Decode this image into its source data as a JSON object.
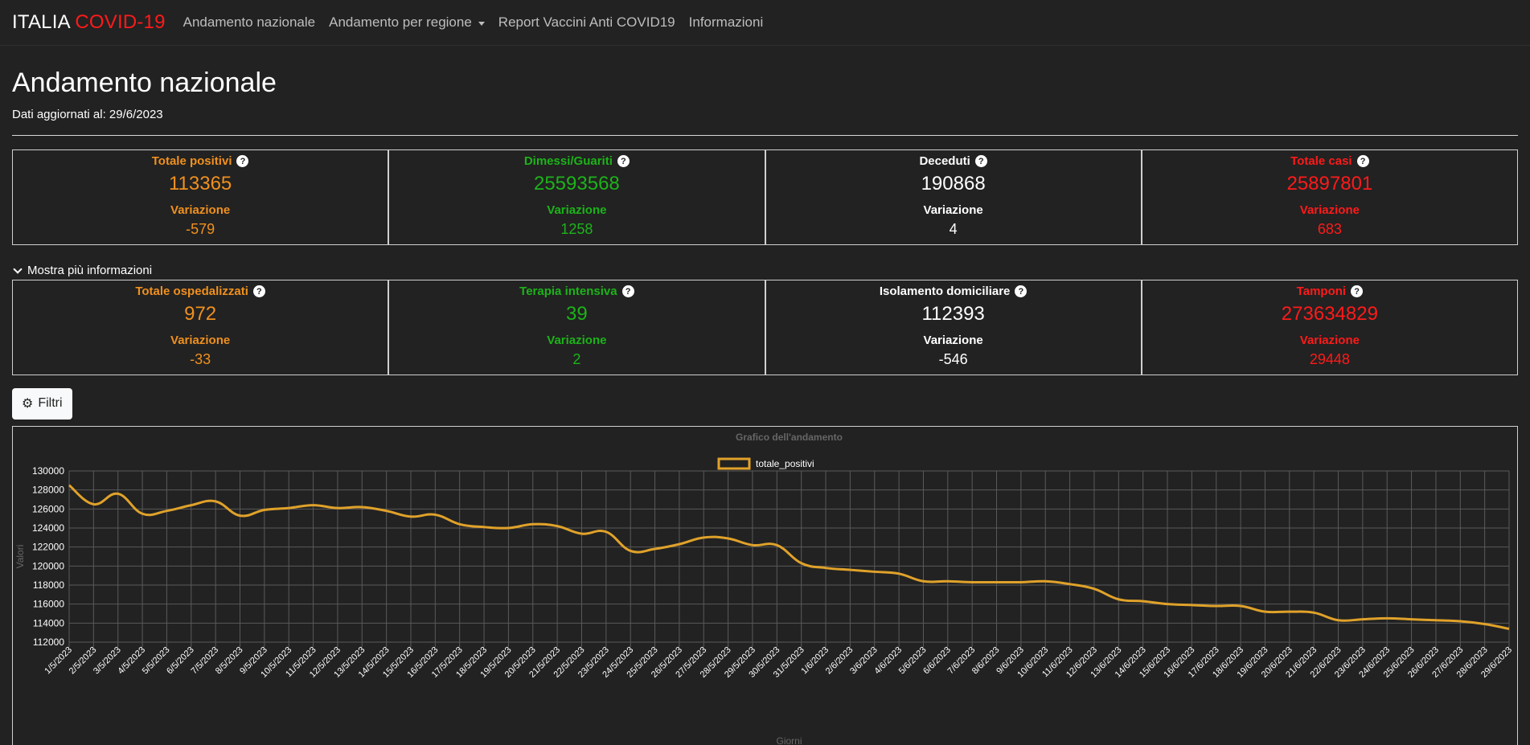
{
  "navbar": {
    "brand_left": "ITALIA",
    "brand_right": "COVID-19",
    "links": [
      "Andamento nazionale",
      "Andamento per regione",
      "Report Vaccini Anti COVID19",
      "Informazioni"
    ]
  },
  "page": {
    "title": "Andamento nazionale",
    "updated": "Dati aggiornati al: 29/6/2023",
    "more_info": "Mostra più informazioni",
    "filter_button": "Filtri"
  },
  "cards_top": [
    {
      "title": "Totale positivi",
      "value": "113365",
      "sub": "Variazione",
      "variation": "-579",
      "color": "#f0901e"
    },
    {
      "title": "Dimessi/Guariti",
      "value": "25593568",
      "sub": "Variazione",
      "variation": "1258",
      "color": "#1cb319"
    },
    {
      "title": "Deceduti",
      "value": "190868",
      "sub": "Variazione",
      "variation": "4",
      "color": "#ffffff"
    },
    {
      "title": "Totale casi",
      "value": "25897801",
      "sub": "Variazione",
      "variation": "683",
      "color": "#ff1a1a"
    }
  ],
  "cards_bottom": [
    {
      "title": "Totale ospedalizzati",
      "value": "972",
      "sub": "Variazione",
      "variation": "-33",
      "color": "#f0901e"
    },
    {
      "title": "Terapia intensiva",
      "value": "39",
      "sub": "Variazione",
      "variation": "2",
      "color": "#1cb319"
    },
    {
      "title": "Isolamento domiciliare",
      "value": "112393",
      "sub": "Variazione",
      "variation": "-546",
      "color": "#ffffff"
    },
    {
      "title": "Tamponi",
      "value": "273634829",
      "sub": "Variazione",
      "variation": "29448",
      "color": "#ff1a1a"
    }
  ],
  "icons": {
    "help": "question-circle-icon",
    "expand": "chevron-down-icon",
    "filter": "gears-icon"
  },
  "chart_data": {
    "type": "line",
    "title": "Grafico dell'andamento",
    "xlabel": "Giorni",
    "ylabel": "Valori",
    "ylim": [
      112000,
      130000
    ],
    "yticks": [
      112000,
      114000,
      116000,
      118000,
      120000,
      122000,
      124000,
      126000,
      128000,
      130000
    ],
    "grid": true,
    "legend": "top-center",
    "color": "#e0a22a",
    "categories": [
      "1/5/2023",
      "2/5/2023",
      "3/5/2023",
      "4/5/2023",
      "5/5/2023",
      "6/5/2023",
      "7/5/2023",
      "8/5/2023",
      "9/5/2023",
      "10/5/2023",
      "11/5/2023",
      "12/5/2023",
      "13/5/2023",
      "14/5/2023",
      "15/5/2023",
      "16/5/2023",
      "17/5/2023",
      "18/5/2023",
      "19/5/2023",
      "20/5/2023",
      "21/5/2023",
      "22/5/2023",
      "23/5/2023",
      "24/5/2023",
      "25/5/2023",
      "26/5/2023",
      "27/5/2023",
      "28/5/2023",
      "29/5/2023",
      "30/5/2023",
      "31/5/2023",
      "1/6/2023",
      "2/6/2023",
      "3/6/2023",
      "4/6/2023",
      "5/6/2023",
      "6/6/2023",
      "7/6/2023",
      "8/6/2023",
      "9/6/2023",
      "10/6/2023",
      "11/6/2023",
      "12/6/2023",
      "13/6/2023",
      "14/6/2023",
      "15/6/2023",
      "16/6/2023",
      "17/6/2023",
      "18/6/2023",
      "19/6/2023",
      "20/6/2023",
      "21/6/2023",
      "22/6/2023",
      "23/6/2023",
      "24/6/2023",
      "25/6/2023",
      "26/6/2023",
      "27/6/2023",
      "28/6/2023",
      "29/6/2023"
    ],
    "series": [
      {
        "name": "totale_positivi",
        "values": [
          128500,
          126500,
          127600,
          125500,
          125800,
          126400,
          126800,
          125300,
          125900,
          126100,
          126400,
          126100,
          126200,
          125800,
          125200,
          125400,
          124400,
          124100,
          124000,
          124400,
          124200,
          123400,
          123600,
          121600,
          121800,
          122300,
          123000,
          122900,
          122200,
          122200,
          120300,
          119800,
          119600,
          119400,
          119200,
          118400,
          118400,
          118300,
          118300,
          118300,
          118400,
          118100,
          117600,
          116500,
          116300,
          116000,
          115900,
          115800,
          115800,
          115200,
          115200,
          115100,
          114300,
          114400,
          114500,
          114400,
          114300,
          114200,
          113900,
          113400
        ]
      }
    ]
  }
}
